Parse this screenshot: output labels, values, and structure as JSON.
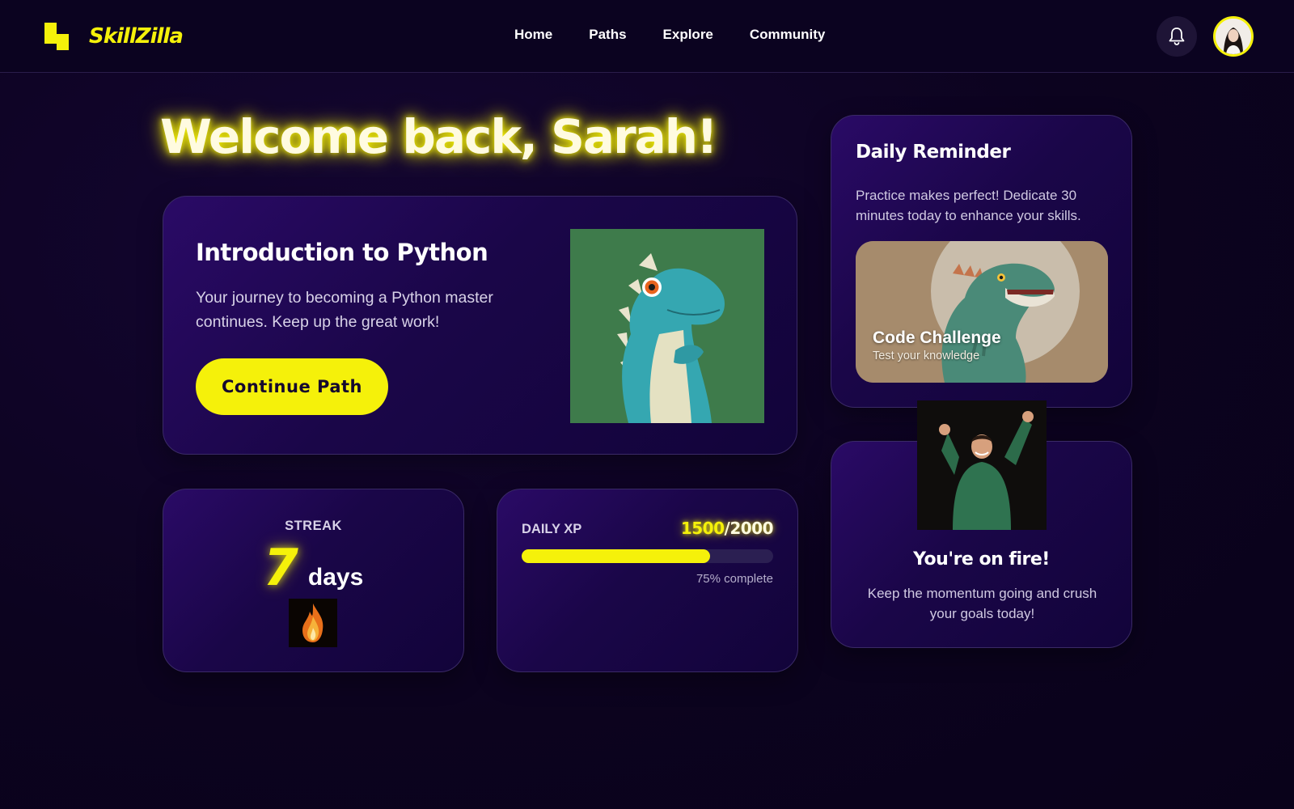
{
  "header": {
    "logo_text": "SkillZilla",
    "nav": [
      "Home",
      "Paths",
      "Explore",
      "Community"
    ],
    "icons": {
      "notifications": "bell-icon",
      "profile": "avatar"
    }
  },
  "welcome": {
    "title": "Welcome back, Sarah!"
  },
  "course": {
    "title": "Introduction to Python",
    "description": "Your journey to becoming a Python master continues. Keep up the great work!",
    "button_label": "Continue Path"
  },
  "streak": {
    "label": "STREAK",
    "value": "7",
    "unit": "days"
  },
  "xp": {
    "label": "DAILY XP",
    "current": "1500",
    "separator": "/",
    "goal": "2000",
    "progress_fraction": 0.75,
    "percent_text": "75% complete"
  },
  "reminder": {
    "title": "Daily Reminder",
    "text": "Practice makes perfect! Dedicate 30 minutes today to enhance your skills.",
    "challenge_title": "Code Challenge",
    "challenge_sub": "Test your knowledge"
  },
  "onfire": {
    "title": "You're on fire!",
    "text": "Keep the momentum going and crush your goals today!"
  },
  "colors": {
    "accent": "#f5f10a",
    "background": "#0c031f",
    "card": "#1a0648"
  }
}
